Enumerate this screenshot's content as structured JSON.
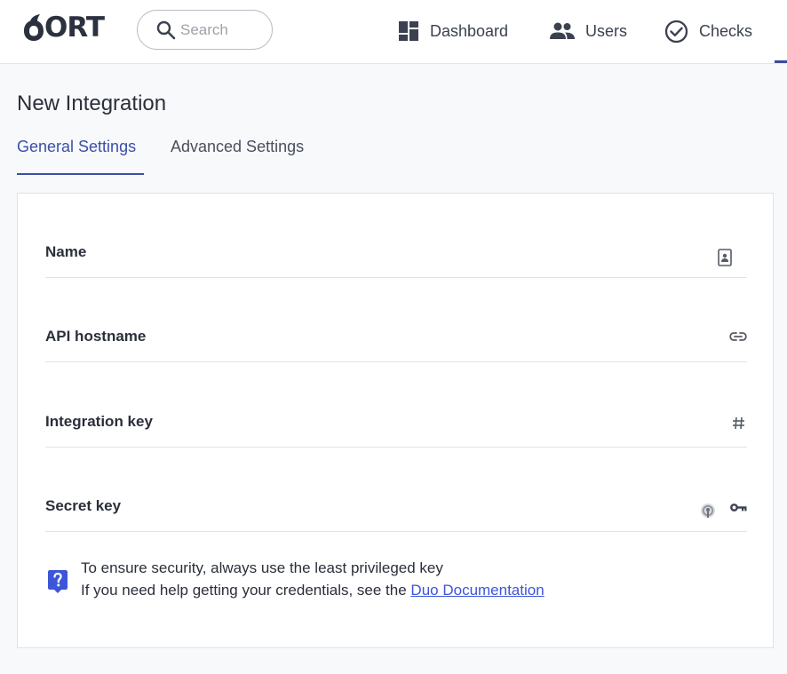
{
  "brand": {
    "name": "ORT"
  },
  "search": {
    "placeholder": "Search"
  },
  "nav": {
    "dashboard": "Dashboard",
    "users": "Users",
    "checks": "Checks"
  },
  "page": {
    "title": "New Integration"
  },
  "tabs": {
    "general": "General Settings",
    "advanced": "Advanced Settings"
  },
  "fields": [
    {
      "label": "Name",
      "icon": "id-badge-icon"
    },
    {
      "label": "API hostname",
      "icon": "link-icon"
    },
    {
      "label": "Integration key",
      "icon": "hash-icon"
    },
    {
      "label": "Secret key",
      "icon": "key-icon"
    }
  ],
  "help": {
    "line1": "To ensure security, always use the least privileged key",
    "line2_prefix": "If you need help getting your credentials, see the ",
    "link_text": "Duo Documentation"
  },
  "colors": {
    "accent": "#3a4fa8",
    "link": "#3d55d8",
    "help_icon": "#3d55d8",
    "logo": "#2c3140"
  }
}
